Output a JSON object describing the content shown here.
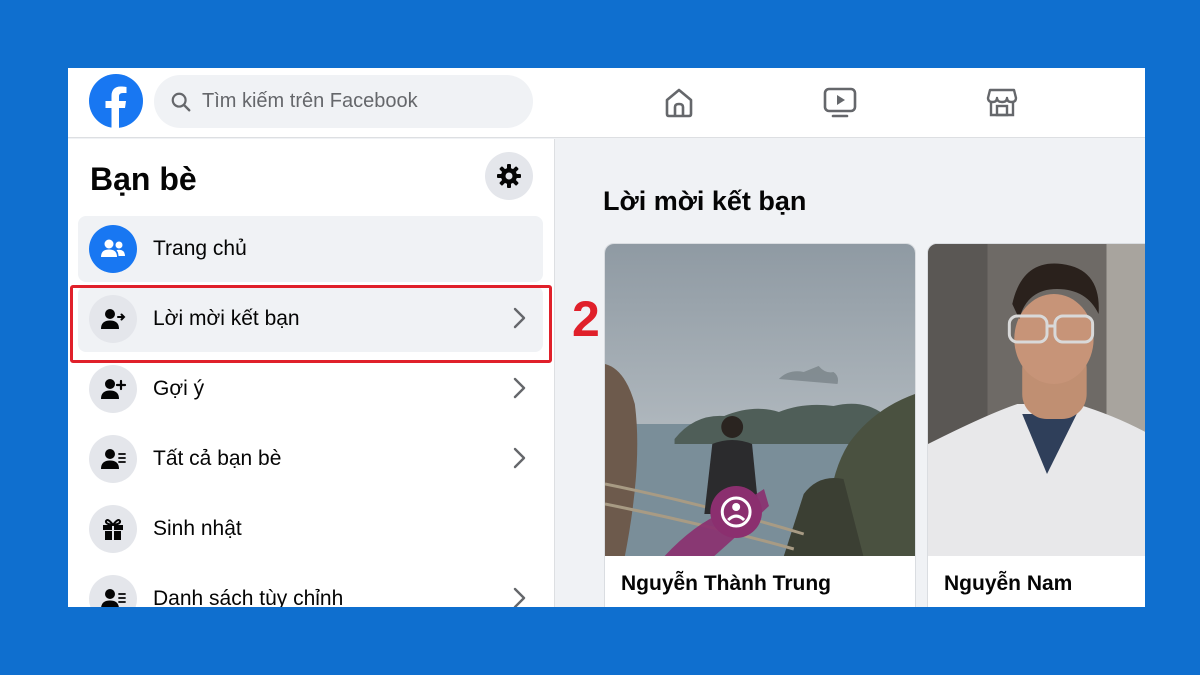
{
  "search": {
    "placeholder": "Tìm kiếm trên Facebook"
  },
  "topnav": {
    "icons": [
      "home-icon",
      "watch-icon",
      "marketplace-icon"
    ]
  },
  "sidebar": {
    "title": "Bạn bè",
    "items": [
      {
        "label": "Trang chủ",
        "icon": "friends-icon",
        "has_chevron": false
      },
      {
        "label": "Lời mời kết bạn",
        "icon": "friend-request-icon",
        "has_chevron": true
      },
      {
        "label": "Gợi ý",
        "icon": "add-friend-icon",
        "has_chevron": true
      },
      {
        "label": "Tất cả bạn bè",
        "icon": "friend-list-icon",
        "has_chevron": true
      },
      {
        "label": "Sinh nhật",
        "icon": "gift-icon",
        "has_chevron": false
      },
      {
        "label": "Danh sách tùy chỉnh",
        "icon": "custom-list-icon",
        "has_chevron": true
      }
    ]
  },
  "annotation": {
    "step": "2",
    "color": "#e0202a"
  },
  "main": {
    "title": "Lời mời kết bạn",
    "requests": [
      {
        "name": "Nguyễn Thành Trung"
      },
      {
        "name": "Nguyễn Nam"
      }
    ]
  },
  "colors": {
    "brand": "#1877f2",
    "background": "#0f6fcf"
  }
}
